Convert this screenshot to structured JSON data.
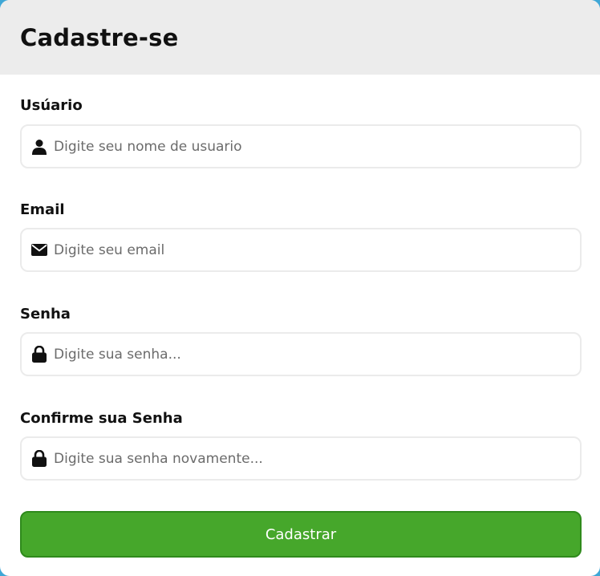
{
  "form": {
    "title": "Cadastre-se",
    "fields": [
      {
        "label": "Usúario",
        "placeholder": "Digite seu nome de usuario",
        "value": "",
        "icon": "user-icon"
      },
      {
        "label": "Email",
        "placeholder": "Digite seu email",
        "value": "",
        "icon": "envelope-icon"
      },
      {
        "label": "Senha",
        "placeholder": "Digite sua senha...",
        "value": "",
        "icon": "lock-icon"
      },
      {
        "label": "Confirme sua Senha",
        "placeholder": "Digite sua senha novamente...",
        "value": "",
        "icon": "lock-icon"
      }
    ],
    "submit_label": "Cadastrar"
  },
  "colors": {
    "header_bg": "#ececec",
    "accent_green": "#46a72b",
    "input_border": "#ebebeb"
  }
}
